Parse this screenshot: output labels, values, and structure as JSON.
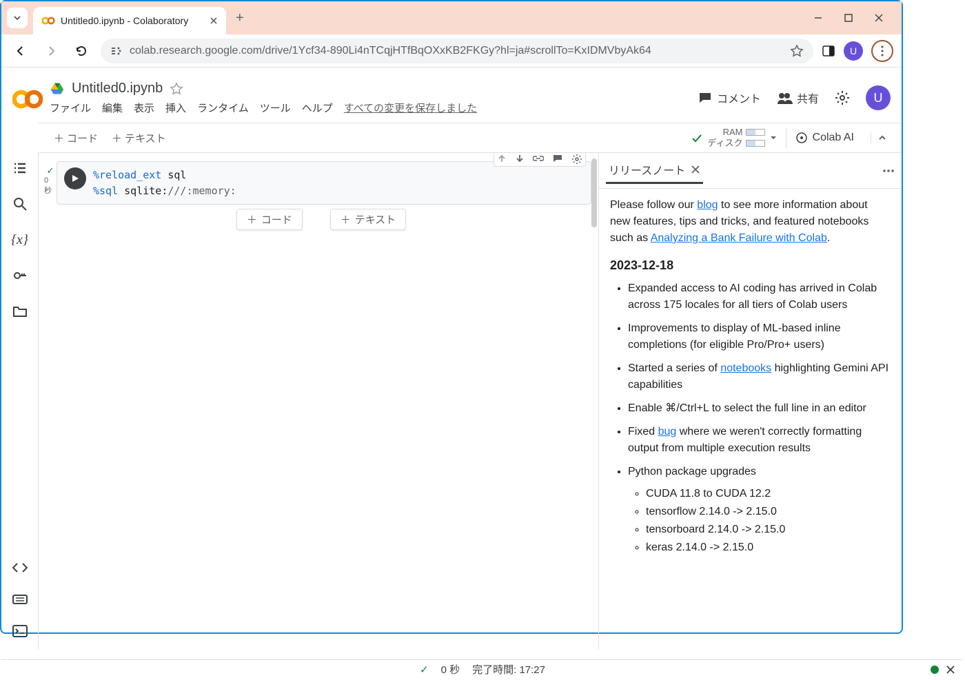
{
  "browser": {
    "tab_title": "Untitled0.ipynb - Colaboratory",
    "url": "colab.research.google.com/drive/1Ycf34-890Li4nTCqjHTfBqOXxKB2FKGy?hl=ja#scrollTo=KxIDMVbyAk64",
    "avatar_letter": "U"
  },
  "colab": {
    "notebook_title": "Untitled0.ipynb",
    "menus": [
      "ファイル",
      "編集",
      "表示",
      "挿入",
      "ランタイム",
      "ツール",
      "ヘルプ"
    ],
    "save_status": "すべての変更を保存しました",
    "actions": {
      "comment": "コメント",
      "share": "共有"
    },
    "avatar_letter": "U",
    "toolbar": {
      "code": "コード",
      "text": "テキスト",
      "ram": "RAM",
      "disk": "ディスク",
      "colab_ai": "Colab AI"
    },
    "cell": {
      "status_time": "0 秒",
      "line1_magic": "%reload_ext",
      "line1_rest": " sql",
      "line2_magic": "%sql",
      "line2_rest": " sqlite:",
      "line2_path": "///:memory:"
    },
    "midbuttons": {
      "code": "コード",
      "text": "テキスト"
    }
  },
  "panel": {
    "title": "リリースノート",
    "intro_prefix": "Please follow our ",
    "intro_link1": "blog",
    "intro_mid": " to see more information about new features, tips and tricks, and featured notebooks such as ",
    "intro_link2": "Analyzing a Bank Failure with Colab",
    "intro_suffix": ".",
    "date": "2023-12-18",
    "items": [
      "Expanded access to AI coding has arrived in Colab across 175 locales for all tiers of Colab users",
      "Improvements to display of ML-based inline completions (for eligible Pro/Pro+ users)"
    ],
    "item3_pre": "Started a series of ",
    "item3_link": "notebooks",
    "item3_post": " highlighting Gemini API capabilities",
    "item4": "Enable ⌘/Ctrl+L to select the full line in an editor",
    "item5_pre": "Fixed ",
    "item5_link": "bug",
    "item5_post": " where we weren't correctly formatting output from multiple execution results",
    "item6": "Python package upgrades",
    "subitems": [
      "CUDA 11.8 to CUDA 12.2",
      "tensorflow 2.14.0 -> 2.15.0",
      "tensorboard 2.14.0 -> 2.15.0",
      "keras 2.14.0 -> 2.15.0"
    ]
  },
  "status": {
    "duration": "0 秒",
    "completed": "完了時間: 17:27"
  }
}
